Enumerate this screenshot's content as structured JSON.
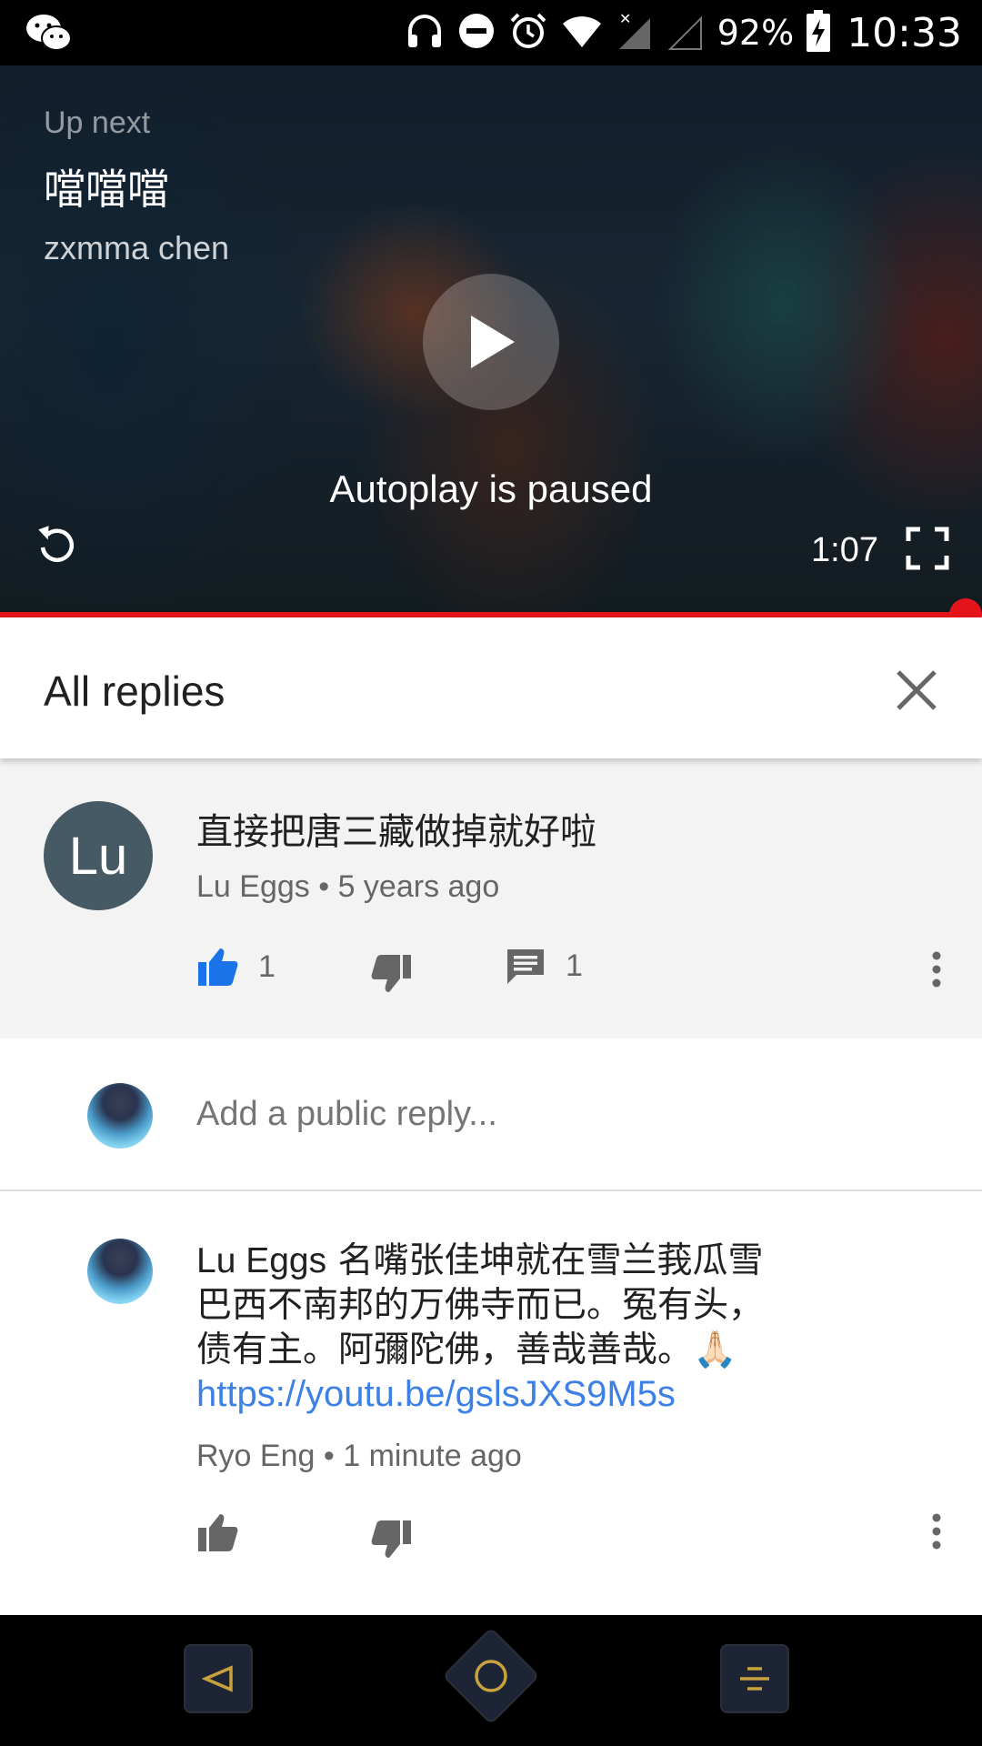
{
  "status_bar": {
    "battery": "92%",
    "time": "10:33",
    "icons": [
      "wechat-icon",
      "headphones-icon",
      "do-not-disturb-icon",
      "alarm-icon",
      "wifi-icon",
      "signal-icon",
      "signal-empty-icon",
      "battery-charging-icon"
    ]
  },
  "player": {
    "up_next_label": "Up next",
    "next_title": "噹噹噹",
    "next_channel": "zxmma chen",
    "autoplay_text": "Autoplay is paused",
    "duration": "1:07",
    "progress": 1.0
  },
  "replies": {
    "title": "All replies"
  },
  "parent_comment": {
    "avatar_initials": "Lu",
    "avatar_color": "#455a64",
    "text": "直接把唐三藏做掉就好啦",
    "author": "Lu Eggs",
    "time": "5 years ago",
    "likes": "1",
    "reply_count": "1"
  },
  "add_reply": {
    "placeholder": "Add a public reply..."
  },
  "reply": {
    "mention": "Lu Eggs",
    "lines": [
      "名嘴张佳坤就在雪兰莪瓜雪",
      "巴西不南邦的万佛寺而已。冤有头，",
      "债有主。阿彌陀佛，善哉善哉。🙏🏻"
    ],
    "link": "https://youtu.be/gslsJXS9M5s",
    "author": "Ryo Eng",
    "time": "1 minute ago"
  },
  "colors": {
    "like_active": "#1a73e8",
    "link": "#3d80e6",
    "progress": "#e5141a"
  }
}
